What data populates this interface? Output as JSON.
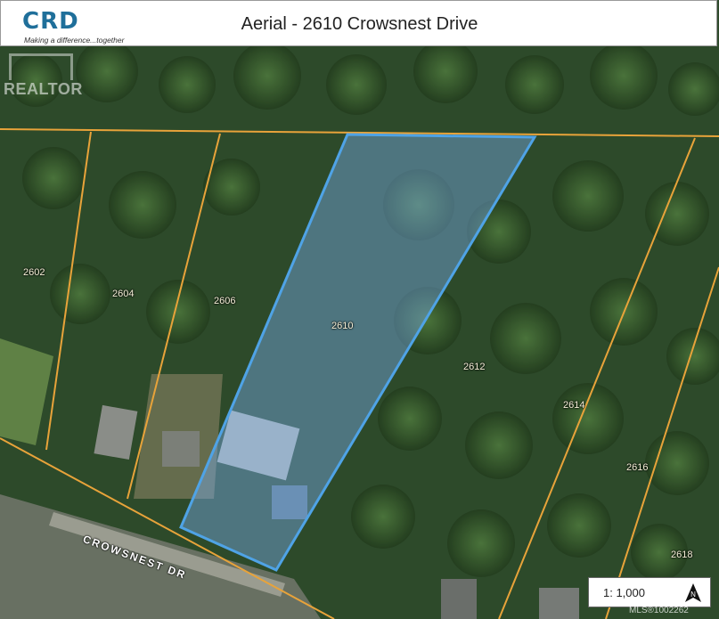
{
  "header": {
    "logo_text": "CRD",
    "logo_tagline": "Making a difference...together",
    "title": "Aerial - 2610 Crowsnest Drive"
  },
  "watermark": {
    "text": "REALTOR"
  },
  "lots": {
    "l2602": "2602",
    "l2604": "2604",
    "l2606": "2606",
    "l2610": "2610",
    "l2612": "2612",
    "l2614": "2614",
    "l2616": "2616",
    "l2618": "2618"
  },
  "street_label": "CROWSNEST DR",
  "scale": {
    "text": "1: 1,000",
    "north_icon": "north-arrow-icon"
  },
  "mls_watermark": "MLS®1002262",
  "colors": {
    "lot_lines": "#e8a33a",
    "highlight_outline": "#4fa3e6",
    "highlight_fill": "rgba(120,170,230,0.45)",
    "logo_blue": "#1f6f9a"
  }
}
